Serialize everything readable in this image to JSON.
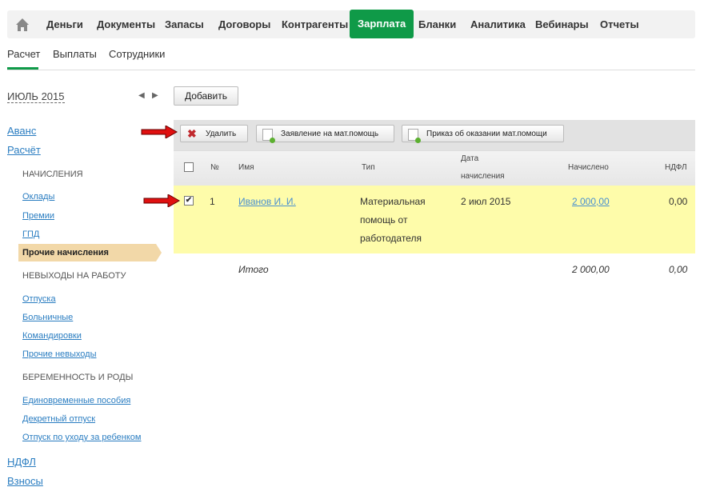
{
  "topnav": {
    "items": [
      "Деньги",
      "Документы",
      "Запасы",
      "Договоры",
      "Контрагенты",
      "Зарплата",
      "Бланки",
      "Аналитика",
      "Вебинары",
      "Отчеты"
    ],
    "active": "Зарплата"
  },
  "subnav": {
    "items": [
      "Расчет",
      "Выплаты",
      "Сотрудники"
    ]
  },
  "period": "ИЮЛЬ 2015",
  "add_button": "Добавить",
  "sidebar": {
    "avans": "Аванс",
    "raschet": "Расчёт",
    "sec1": "НАЧИСЛЕНИЯ",
    "okl": "Оклады",
    "prem": "Премии",
    "gpd": "ГПД",
    "other": "Прочие начисления",
    "sec2": "НЕВЫХОДЫ НА РАБОТУ",
    "otp": "Отпуска",
    "boln": "Больничные",
    "kom": "Командировки",
    "pnev": "Прочие невыходы",
    "sec3": "БЕРЕМЕННОСТЬ И РОДЫ",
    "edin": "Единовременные пособия",
    "dekr": "Декретный отпуск",
    "uhod": "Отпуск по уходу за ребенком",
    "ndfl": "НДФЛ",
    "vznosy": "Взносы"
  },
  "toolbar": {
    "delete": "Удалить",
    "zayav": "Заявление на мат.помощь",
    "prikaz": "Приказ об оказании мат.помощи"
  },
  "table": {
    "headers": {
      "num": "№",
      "name": "Имя",
      "type": "Тип",
      "date1": "Дата",
      "date2": "начисления",
      "accrued": "Начислено",
      "ndfl": "НДФЛ"
    },
    "rows": [
      {
        "checked": true,
        "num": "1",
        "name": "Иванов И. И.",
        "type": [
          "Материальная",
          "помощь от",
          "работодателя"
        ],
        "date": "2 июл 2015",
        "accrued": "2 000,00",
        "ndfl": "0,00"
      }
    ],
    "total": {
      "label": "Итого",
      "accrued": "2 000,00",
      "ndfl": "0,00"
    }
  }
}
